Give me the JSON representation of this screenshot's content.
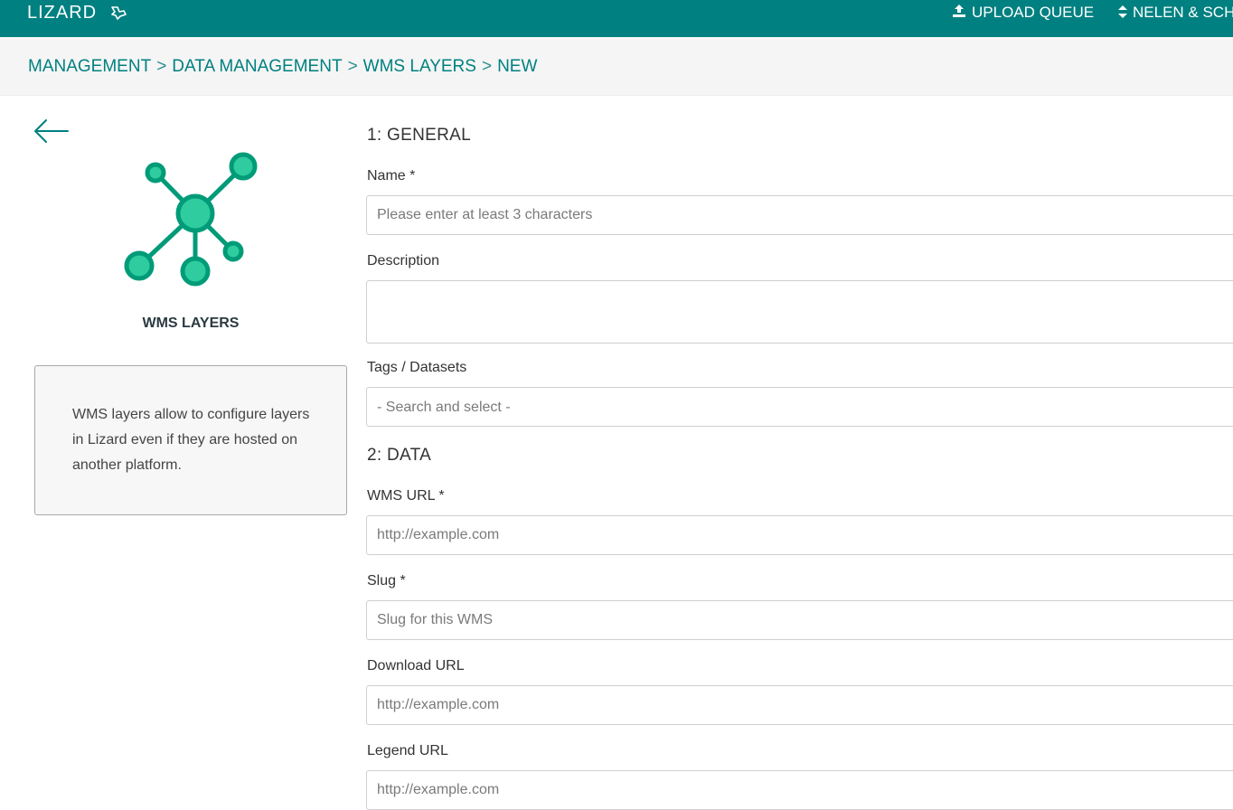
{
  "header": {
    "logo": "LIZARD",
    "upload_queue": "UPLOAD QUEUE",
    "user": "NELEN & SCH"
  },
  "breadcrumb": {
    "items": [
      "MANAGEMENT",
      "DATA MANAGEMENT",
      "WMS LAYERS",
      "NEW"
    ],
    "separator": ">"
  },
  "sidebar": {
    "title": "WMS LAYERS",
    "info": "WMS layers allow to configure layers in Lizard even if they are hosted on another platform.",
    "icon_color": "#2ecc9e",
    "icon_stroke": "#009b78"
  },
  "form": {
    "section1": "1: GENERAL",
    "name_label": "Name *",
    "name_placeholder": "Please enter at least 3 characters",
    "description_label": "Description",
    "tags_label": "Tags / Datasets",
    "tags_placeholder": "- Search and select -",
    "section2": "2: DATA",
    "wms_url_label": "WMS URL *",
    "wms_url_placeholder": "http://example.com",
    "slug_label": "Slug *",
    "slug_placeholder": "Slug for this WMS",
    "download_url_label": "Download URL",
    "download_url_placeholder": "http://example.com",
    "legend_url_label": "Legend URL",
    "legend_url_placeholder": "http://example.com"
  },
  "colors": {
    "brand": "#008080",
    "breadcrumb_bg": "#f5f5f5"
  }
}
